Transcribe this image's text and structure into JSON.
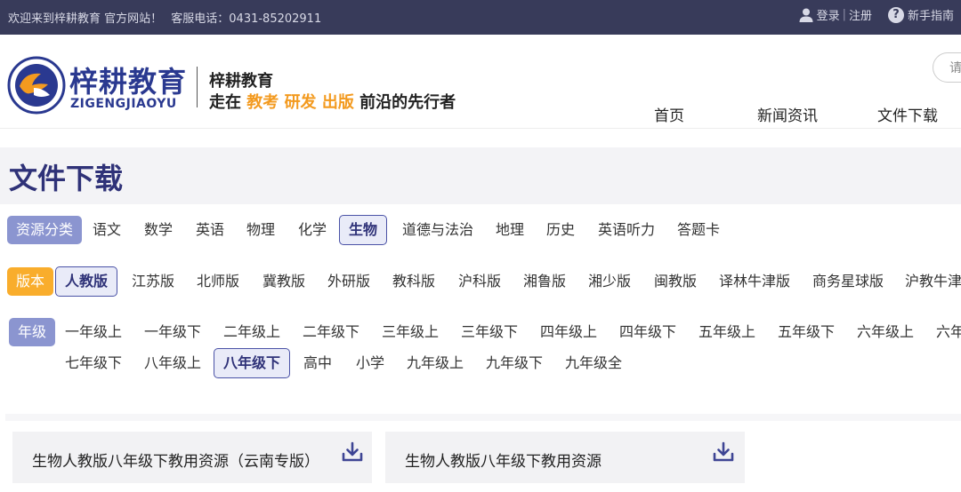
{
  "topbar": {
    "welcome": "欢迎来到梓耕教育 官方网站！",
    "phone": "客服电话：0431-85202911",
    "login": "登录",
    "separator": "|",
    "register": "注册",
    "guide": "新手指南",
    "help_glyph": "?"
  },
  "header": {
    "brand_cn": "梓耕教育",
    "brand_en": "ZIGENGJIAOYU",
    "slogan_line1": "梓耕教育",
    "slogan_line2_prefix": "走在",
    "slogan_hl1": "教考",
    "slogan_hl2": "研发",
    "slogan_hl3": "出版",
    "slogan_line2_suffix": "前沿的先行者",
    "search_placeholder": "请",
    "nav": [
      "首页",
      "新闻资讯",
      "文件下载"
    ]
  },
  "page_title": "文件下载",
  "filters": {
    "subject": {
      "label": "资源分类",
      "options": [
        "语文",
        "数学",
        "英语",
        "物理",
        "化学",
        "生物",
        "道德与法治",
        "地理",
        "历史",
        "英语听力",
        "答题卡"
      ],
      "active": "生物"
    },
    "edition": {
      "label": "版本",
      "options": [
        "人教版",
        "江苏版",
        "北师版",
        "冀教版",
        "外研版",
        "教科版",
        "沪科版",
        "湘鲁版",
        "湘少版",
        "闽教版",
        "译林牛津版",
        "商务星球版",
        "沪教牛津"
      ],
      "active": "人教版"
    },
    "grade": {
      "label": "年级",
      "row1": [
        "一年级上",
        "一年级下",
        "二年级上",
        "二年级下",
        "三年级上",
        "三年级下",
        "四年级上",
        "四年级下",
        "五年级上",
        "五年级下",
        "六年级上",
        "六年"
      ],
      "row2": [
        "七年级下",
        "八年级上",
        "八年级下",
        "高中",
        "小学",
        "九年级上",
        "九年级下",
        "九年级全"
      ],
      "active": "八年级下"
    }
  },
  "resources": [
    {
      "title": "生物人教版八年级下教用资源（云南专版）",
      "icon": "download-icon"
    },
    {
      "title": "生物人教版八年级下教用资源",
      "icon": "download-icon"
    }
  ],
  "colors": {
    "topbar_bg": "#383b5a",
    "brand_blue": "#2a3990",
    "accent_orange": "#f39a1f",
    "title_navy": "#2f3278",
    "label_blue": "#8b95d0",
    "label_orange": "#f9ad2c"
  }
}
